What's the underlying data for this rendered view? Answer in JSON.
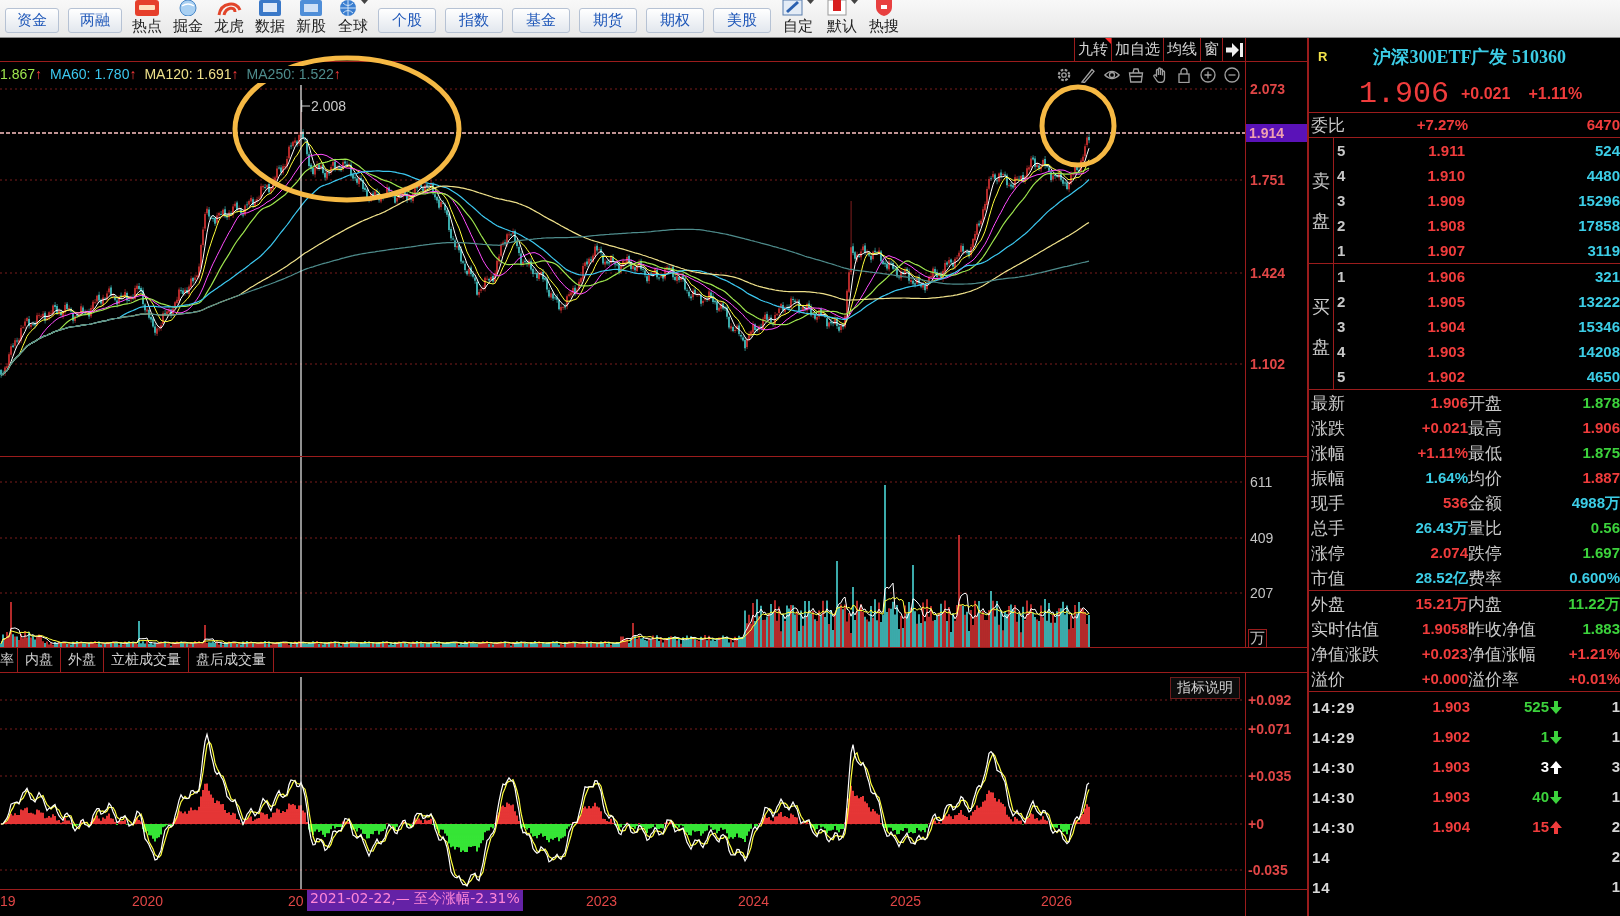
{
  "toolbar": {
    "items": [
      {
        "kind": "button",
        "label": "资金"
      },
      {
        "kind": "button",
        "label": "两融"
      },
      {
        "kind": "tool",
        "label": "热点",
        "dropdown": false
      },
      {
        "kind": "tool",
        "label": "掘金",
        "dropdown": false
      },
      {
        "kind": "tool",
        "label": "龙虎",
        "dropdown": false
      },
      {
        "kind": "tool",
        "label": "数据",
        "dropdown": false
      },
      {
        "kind": "tool",
        "label": "新股",
        "dropdown": false
      },
      {
        "kind": "tool",
        "label": "全球",
        "dropdown": true
      },
      {
        "kind": "button",
        "label": "个股"
      },
      {
        "kind": "button",
        "label": "指数"
      },
      {
        "kind": "button",
        "label": "基金"
      },
      {
        "kind": "button",
        "label": "期货"
      },
      {
        "kind": "button",
        "label": "期权"
      },
      {
        "kind": "button",
        "label": "美股"
      },
      {
        "kind": "tool",
        "label": "自定",
        "dropdown": true
      },
      {
        "kind": "tool",
        "label": "默认",
        "dropdown": true
      },
      {
        "kind": "tool",
        "label": "热搜",
        "dropdown": false
      }
    ]
  },
  "chart": {
    "header_buttons": [
      {
        "label": "九转",
        "flagged": true
      },
      {
        "label": "加自选",
        "flagged": false
      },
      {
        "label": "均线",
        "flagged": false
      },
      {
        "label": "窗",
        "flagged": false
      }
    ],
    "ma_legend": [
      {
        "label": "1.867",
        "arrow": "↑",
        "color": "#9ee64e"
      },
      {
        "label": "MA60: 1.780",
        "arrow": "↑",
        "color": "#3cc8f0"
      },
      {
        "label": "MA120: 1.691",
        "arrow": "↑",
        "color": "#eee08a"
      },
      {
        "label": "MA250: 1.522",
        "arrow": "↑",
        "color": "#4e8c8c"
      }
    ],
    "high_marker": "2.008",
    "price_axis": [
      "2.073",
      "1.751",
      "1.424",
      "1.102"
    ],
    "current_price_tag": "1.914",
    "volume_axis": [
      "611",
      "409",
      "207"
    ],
    "volume_unit": "万",
    "indicator_tabs": [
      "率",
      "内盘",
      "外盘",
      "立桩成交量",
      "盘后成交量"
    ],
    "indicator_help": "指标说明",
    "indicator_axis": [
      "+0.092",
      "+0.071",
      "+0.035",
      "+0",
      "-0.035"
    ],
    "x_axis": [
      "19",
      "2020",
      "20",
      "2023",
      "2024",
      "2025",
      "2026"
    ],
    "cursor_tooltip": "2021-02-22,— 至今涨幅-2.31%"
  },
  "quote": {
    "badge": "R",
    "title": "沪深300ETF广发 510360",
    "price": "1.906",
    "change": "+0.021",
    "change_pct": "+1.11%",
    "commission": {
      "label": "委比",
      "value": "+7.27%",
      "diff": "6470"
    },
    "sell_label": "卖盘",
    "sell": [
      {
        "level": "5",
        "price": "1.911",
        "volume": "524"
      },
      {
        "level": "4",
        "price": "1.910",
        "volume": "4480"
      },
      {
        "level": "3",
        "price": "1.909",
        "volume": "15296"
      },
      {
        "level": "2",
        "price": "1.908",
        "volume": "17858"
      },
      {
        "level": "1",
        "price": "1.907",
        "volume": "3119"
      }
    ],
    "buy_label": "买盘",
    "buy": [
      {
        "level": "1",
        "price": "1.906",
        "volume": "321"
      },
      {
        "level": "2",
        "price": "1.905",
        "volume": "13222"
      },
      {
        "level": "3",
        "price": "1.904",
        "volume": "15346"
      },
      {
        "level": "4",
        "price": "1.903",
        "volume": "14208"
      },
      {
        "level": "5",
        "price": "1.902",
        "volume": "4650"
      }
    ],
    "stats": [
      {
        "label": "最新",
        "value": "1.906",
        "color": "#f03c3c"
      },
      {
        "label": "开盘",
        "value": "1.878",
        "color": "#3cd23c"
      },
      {
        "label": "涨跌",
        "value": "+0.021",
        "color": "#f03c3c"
      },
      {
        "label": "最高",
        "value": "1.906",
        "color": "#f03c3c"
      },
      {
        "label": "涨幅",
        "value": "+1.11%",
        "color": "#f03c3c"
      },
      {
        "label": "最低",
        "value": "1.875",
        "color": "#3cd23c"
      },
      {
        "label": "振幅",
        "value": "1.64%",
        "color": "#3ccde6"
      },
      {
        "label": "均价",
        "value": "1.887",
        "color": "#f03c3c"
      },
      {
        "label": "现手",
        "value": "536",
        "color": "#f03c3c"
      },
      {
        "label": "金额",
        "value": "4988万",
        "color": "#3ccde6"
      },
      {
        "label": "总手",
        "value": "26.43万",
        "color": "#3ccde6"
      },
      {
        "label": "量比",
        "value": "0.56",
        "color": "#3cd23c"
      },
      {
        "label": "涨停",
        "value": "2.074",
        "color": "#f03c3c"
      },
      {
        "label": "跌停",
        "value": "1.697",
        "color": "#3cd23c"
      },
      {
        "label": "市值",
        "value": "28.52亿",
        "color": "#3ccde6"
      },
      {
        "label": "费率",
        "value": "0.600%",
        "color": "#3ccde6"
      }
    ],
    "fund_stats": [
      {
        "label": "外盘",
        "value": "15.21万",
        "color": "#f03c3c"
      },
      {
        "label": "内盘",
        "value": "11.22万",
        "color": "#3cd23c"
      },
      {
        "label": "实时估值",
        "value": "1.9058",
        "color": "#f03c3c"
      },
      {
        "label": "昨收净值",
        "value": "1.883",
        "color": "#3cd23c"
      },
      {
        "label": "净值涨跌",
        "value": "+0.023",
        "color": "#f03c3c"
      },
      {
        "label": "净值涨幅",
        "value": "+1.21%",
        "color": "#f03c3c"
      },
      {
        "label": "溢价",
        "value": "+0.000",
        "color": "#f03c3c"
      },
      {
        "label": "溢价率",
        "value": "+0.01%",
        "color": "#f03c3c"
      }
    ],
    "ticks": [
      {
        "kind": "sell",
        "time": "14:29",
        "price": "1.903",
        "volume": "525",
        "color": "#3cd23c",
        "column_5": "1"
      },
      {
        "kind": "sell",
        "time": "14:29",
        "price": "1.902",
        "volume": "1",
        "color": "#3cd23c",
        "column_5": "1"
      },
      {
        "kind": "buy",
        "time": "14:30",
        "price": "1.903",
        "volume": "3",
        "color": "#ffffff",
        "column_5": "3"
      },
      {
        "kind": "sell",
        "time": "14:30",
        "price": "1.903",
        "volume": "40",
        "color": "#3cd23c",
        "column_5": "1"
      },
      {
        "kind": "buy",
        "time": "14:30",
        "price": "1.904",
        "volume": "15",
        "color": "#f03c3c",
        "column_5": "2"
      },
      {
        "kind": "partial",
        "time": "14",
        "column_5": "2"
      },
      {
        "kind": "partial",
        "time": "14",
        "column_5": "1"
      }
    ]
  }
}
